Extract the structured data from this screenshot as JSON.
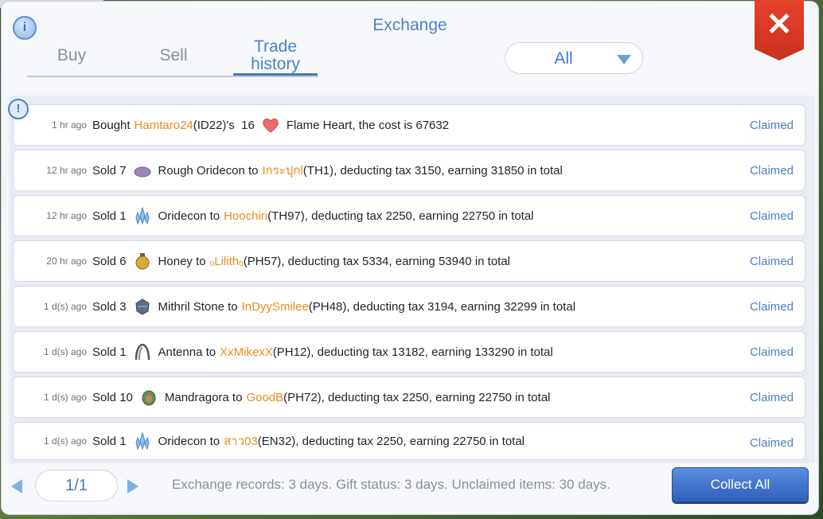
{
  "window": {
    "title": "Exchange"
  },
  "tabs": [
    {
      "label": "Buy",
      "active": false
    },
    {
      "label": "Sell",
      "active": false
    },
    {
      "label": "Trade history",
      "active": true
    }
  ],
  "filter": {
    "selected": "All"
  },
  "records": [
    {
      "time": "1 hr ago",
      "verb": "Bought",
      "player": "Hamtaro24",
      "rest": "(ID22)'s  16",
      "item": "Flame Heart, the cost is 67632",
      "icon": "flame-heart-icon",
      "status": "Claimed"
    },
    {
      "time": "12 hr ago",
      "verb": "Sold 7",
      "item": "Rough Oridecon to",
      "player": "Iกระปุกl",
      "rest": "(TH1), deducting tax 3150, earning 31850 in total",
      "icon": "rough-oridecon-icon",
      "status": "Claimed"
    },
    {
      "time": "12 hr ago",
      "verb": "Sold 1",
      "item": "Oridecon to",
      "player": "Hoochiri",
      "rest": "(TH97), deducting tax 2250, earning 22750 in total",
      "icon": "oridecon-icon",
      "status": "Claimed"
    },
    {
      "time": "20 hr ago",
      "verb": "Sold 6",
      "item": "Honey to",
      "player": "ₒLilithₒ",
      "rest": "(PH57), deducting tax 5334, earning 53940 in total",
      "icon": "honey-icon",
      "status": "Claimed"
    },
    {
      "time": "1 d(s) ago",
      "verb": "Sold 3",
      "item": "Mithril Stone to",
      "player": "InDyySmilee",
      "rest": "(PH48), deducting tax 3194, earning 32299 in total",
      "icon": "mithril-stone-icon",
      "status": "Claimed"
    },
    {
      "time": "1 d(s) ago",
      "verb": "Sold 1",
      "item": "Antenna to",
      "player": "XxMikexX",
      "rest": "(PH12), deducting tax 13182, earning 133290 in total",
      "icon": "antenna-icon",
      "status": "Claimed"
    },
    {
      "time": "1 d(s) ago",
      "verb": "Sold 10",
      "item": "Mandragora to",
      "player": "GoodB",
      "rest": "(PH72), deducting tax 2250, earning 22750 in total",
      "icon": "mandragora-icon",
      "status": "Claimed"
    },
    {
      "time": "1 d(s) ago",
      "verb": "Sold 1",
      "item": "Oridecon to",
      "player": "สาว03",
      "rest": "(EN32), deducting tax 2250, earning 22750 in total",
      "icon": "oridecon-icon",
      "status": "Claimed"
    }
  ],
  "pagination": {
    "label": "1/1"
  },
  "footer": {
    "note": "Exchange records: 3 days. Gift status: 3 days. Unclaimed items: 30 days.",
    "collect_label": "Collect All"
  },
  "colors": {
    "accent": "#4a83c4",
    "player": "#f08a1e",
    "close": "#e0402c"
  }
}
